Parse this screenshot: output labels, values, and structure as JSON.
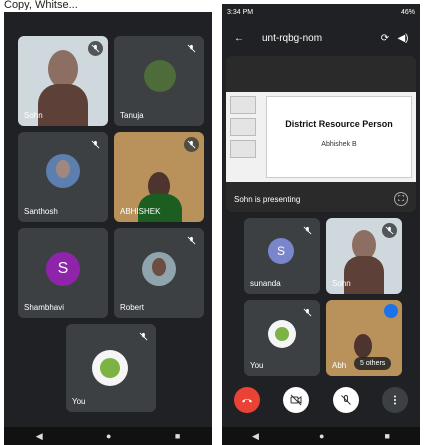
{
  "top_crop_text": "Copy, Whitse...",
  "left_screen": {
    "participants": [
      {
        "name": "Sohn",
        "muted": true
      },
      {
        "name": "Tanuja",
        "muted": true
      },
      {
        "name": "Santhosh",
        "muted": true
      },
      {
        "name": "ABHISHEK",
        "muted": true
      },
      {
        "name": "Shambhavi",
        "initial": "S",
        "muted": true
      },
      {
        "name": "Robert",
        "muted": true
      },
      {
        "name": "You",
        "muted": true
      }
    ],
    "nav": [
      "◀",
      "●",
      "■"
    ]
  },
  "right_screen": {
    "status_time": "3:34 PM",
    "status_battery": "46%",
    "meeting_code": "unt-rqbg-nom",
    "slide": {
      "title": "District Resource Person",
      "subtitle": "Abhishek B"
    },
    "presenting_text": "Sohn is presenting",
    "tiles": [
      {
        "name": "sunanda",
        "initial": "S"
      },
      {
        "name": "Sohn"
      },
      {
        "name": "You"
      },
      {
        "name": "Abh"
      }
    ],
    "others_label": "5 others",
    "nav": [
      "◀",
      "●",
      "■"
    ]
  },
  "colors": {
    "background": "#202124",
    "tile": "#3c4043",
    "shambhavi_avatar": "#8e24aa",
    "sunanda_avatar": "#7986cb",
    "end_call": "#ea4335"
  }
}
